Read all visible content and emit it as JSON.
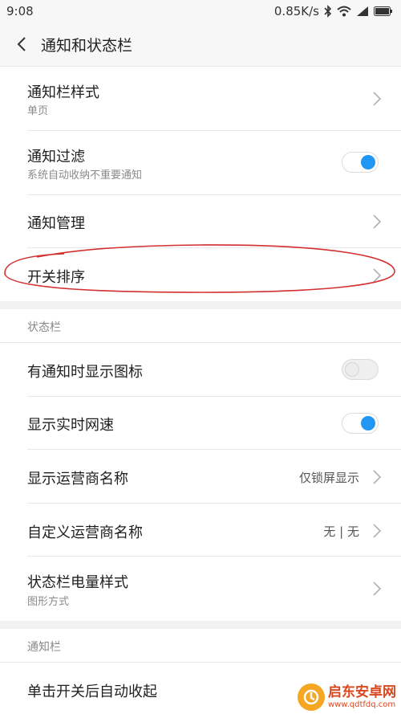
{
  "status_bar": {
    "time": "9:08",
    "speed": "0.85K/s"
  },
  "header": {
    "title": "通知和状态栏"
  },
  "rows": {
    "style": {
      "label": "通知栏样式",
      "sub": "单页"
    },
    "filter": {
      "label": "通知过滤",
      "sub": "系统自动收纳不重要通知",
      "on": true
    },
    "manage": {
      "label": "通知管理"
    },
    "order": {
      "label": "开关排序"
    },
    "show_icon": {
      "label": "有通知时显示图标",
      "on": false
    },
    "net_speed": {
      "label": "显示实时网速",
      "on": true
    },
    "carrier": {
      "label": "显示运营商名称",
      "value": "仅锁屏显示"
    },
    "custom_carrier": {
      "label": "自定义运营商名称",
      "value": "无 | 无"
    },
    "battery": {
      "label": "状态栏电量样式",
      "sub": "图形方式"
    },
    "auto_collapse": {
      "label": "单击开关后自动收起"
    }
  },
  "sections": {
    "status_bar": "状态栏",
    "notification_bar": "通知栏"
  },
  "watermark": {
    "name": "启东安卓网",
    "url": "www.qdtfdq.com"
  },
  "colors": {
    "accent": "#2196f3",
    "annotation": "#d32f2f"
  }
}
